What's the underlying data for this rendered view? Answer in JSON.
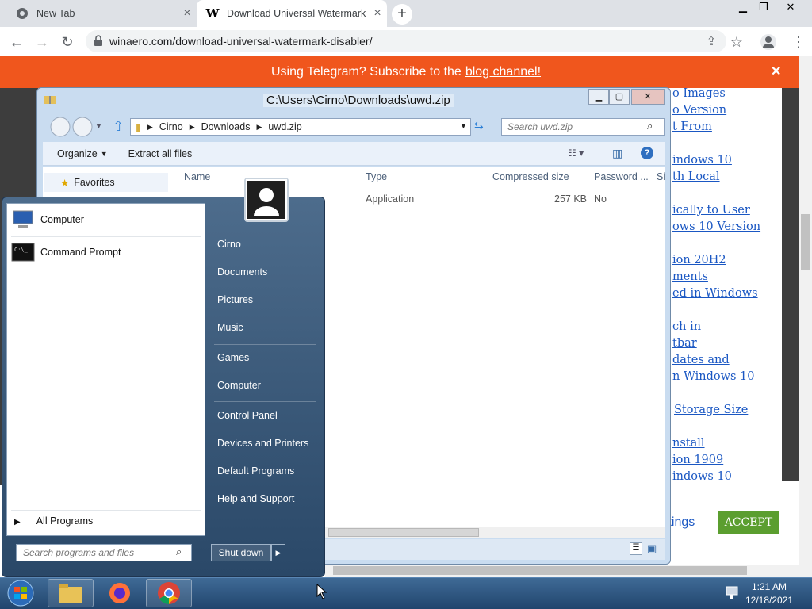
{
  "browser": {
    "tabs": [
      {
        "title": "New Tab"
      },
      {
        "title": "Download Universal Watermark Disabler"
      }
    ],
    "url": "winaero.com/download-universal-watermark-disabler/"
  },
  "banner": {
    "text": "Using Telegram? Subscribe to the",
    "link": "blog channel!"
  },
  "page": {
    "links": [
      "o Images",
      "o Version",
      "t From",
      "indows 10",
      "th Local",
      "ically to User",
      "ows 10 Version",
      "ion 20H2",
      "ments",
      "ed in Windows",
      "ch in",
      "tbar",
      "dates and",
      "n Windows 10",
      "Storage Size",
      "nstall",
      "ion 1909",
      "indows 10"
    ],
    "settings_link": "ttings",
    "accept": "ACCEPT"
  },
  "explorer": {
    "title": "C:\\Users\\Cirno\\Downloads\\uwd.zip",
    "breadcrumb": [
      "Cirno",
      "Downloads",
      "uwd.zip"
    ],
    "search_placeholder": "Search uwd.zip",
    "commands": [
      "Organize",
      "Extract all files"
    ],
    "columns": [
      "Name",
      "Type",
      "Compressed size",
      "Password ...",
      "Si"
    ],
    "row": {
      "type": "Application",
      "size": "257 KB",
      "password": "No"
    },
    "nav": "Favorites"
  },
  "startmenu": {
    "programs": [
      "Computer",
      "Command Prompt"
    ],
    "all_programs": "All Programs",
    "search_placeholder": "Search programs and files",
    "right_items": [
      "Cirno",
      "Documents",
      "Pictures",
      "Music",
      "Games",
      "Computer",
      "Control Panel",
      "Devices and Printers",
      "Default Programs",
      "Help and Support"
    ],
    "shutdown": "Shut down"
  },
  "taskbar": {
    "time": "1:21 AM",
    "date": "12/18/2021"
  },
  "colors": {
    "banner": "#f0561d",
    "accept": "#5b9e2f",
    "link": "#1a57c3"
  }
}
